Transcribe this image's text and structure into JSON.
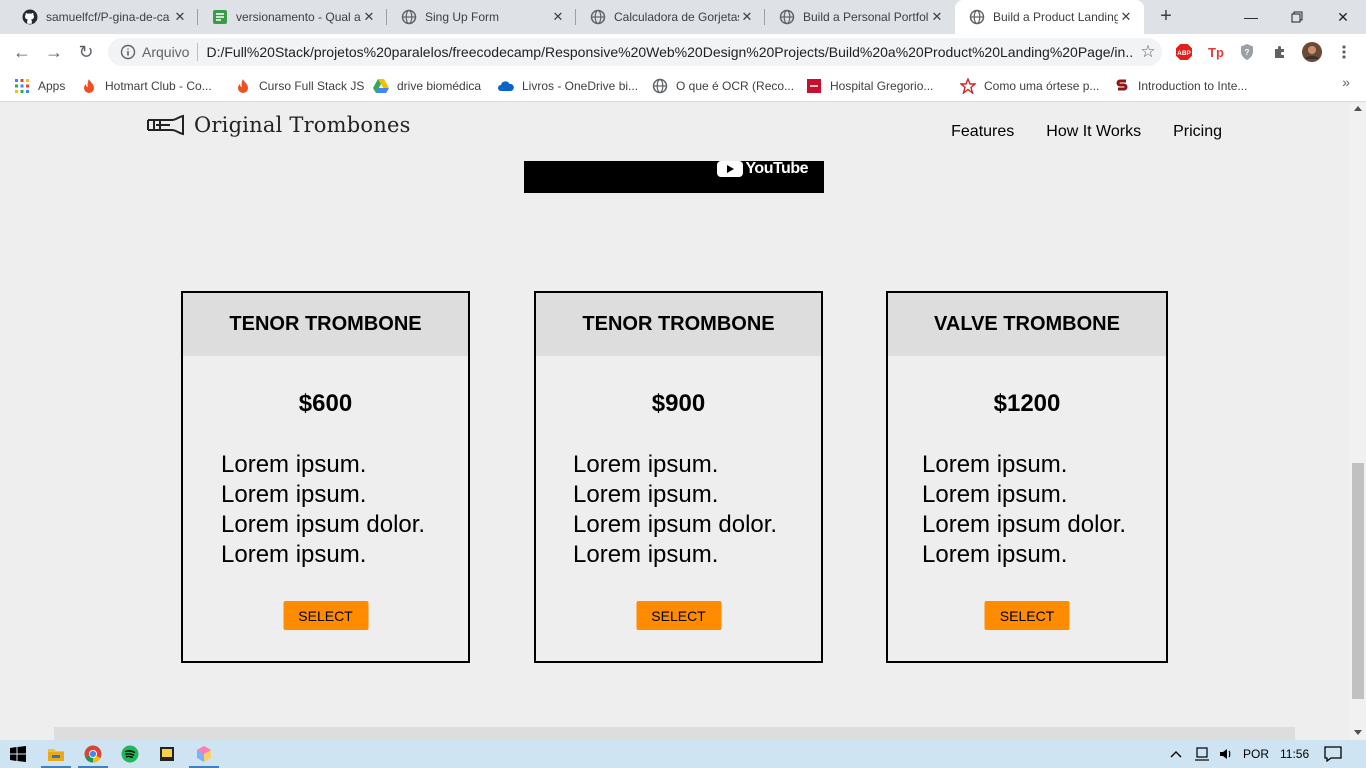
{
  "browser": {
    "tabs": [
      {
        "title": "samuelfcf/P-gina-de-ca",
        "icon": "github-icon"
      },
      {
        "title": "versionamento - Qual a",
        "icon": "stackexchange-icon"
      },
      {
        "title": "Sing Up Form",
        "icon": "globe-icon"
      },
      {
        "title": "Calculadora de Gorjetas",
        "icon": "globe-icon"
      },
      {
        "title": "Build a Personal Portfoli",
        "icon": "globe-icon"
      },
      {
        "title": "Build a Product Landing",
        "icon": "globe-icon",
        "active": true
      }
    ],
    "new_tab_label": "+",
    "address": {
      "scheme_label": "Arquivo",
      "url": "D:/Full%20Stack/projetos%20paralelos/freecodecamp/Responsive%20Web%20Design%20Projects/Build%20a%20Product%20Landing%20Page/in..."
    },
    "extensions": [
      "abp-icon",
      "tp-icon",
      "shield-icon",
      "puzzle-icon",
      "profile-avatar"
    ],
    "bookmarks": [
      {
        "label": "Apps",
        "icon": "apps-grid-icon"
      },
      {
        "label": "Hotmart Club - Co...",
        "icon": "hotmart-icon"
      },
      {
        "label": "Curso Full Stack JS",
        "icon": "hotmart-icon"
      },
      {
        "label": "drive biomédica",
        "icon": "google-drive-icon"
      },
      {
        "label": "Livros - OneDrive bi...",
        "icon": "onedrive-icon"
      },
      {
        "label": "O que é OCR (Reco...",
        "icon": "globe-icon"
      },
      {
        "label": "Hospital Gregorio...",
        "icon": "hospital-icon"
      },
      {
        "label": "Como uma órtese p...",
        "icon": "star-logo-icon"
      },
      {
        "label": "Introduction to Inte...",
        "icon": "stanford-icon"
      }
    ],
    "bookmarks_more": "»"
  },
  "page": {
    "logo_text": "Original Trombones",
    "nav": [
      "Features",
      "How It Works",
      "Pricing"
    ],
    "video_brand": "YouTube",
    "cards": [
      {
        "title": "TENOR TROMBONE",
        "price": "$600",
        "features": [
          "Lorem ipsum.",
          "Lorem ipsum.",
          "Lorem ipsum dolor.",
          "Lorem ipsum."
        ],
        "button": "SELECT"
      },
      {
        "title": "TENOR TROMBONE",
        "price": "$900",
        "features": [
          "Lorem ipsum.",
          "Lorem ipsum.",
          "Lorem ipsum dolor.",
          "Lorem ipsum."
        ],
        "button": "SELECT"
      },
      {
        "title": "VALVE TROMBONE",
        "price": "$1200",
        "features": [
          "Lorem ipsum.",
          "Lorem ipsum.",
          "Lorem ipsum dolor.",
          "Lorem ipsum."
        ],
        "button": "SELECT"
      }
    ]
  },
  "taskbar": {
    "apps": [
      "windows-start-icon",
      "file-explorer-icon",
      "chrome-icon",
      "spotify-icon",
      "sticky-notes-icon",
      "paint-3d-icon"
    ],
    "language": "POR",
    "time": "11:56"
  },
  "colors": {
    "accent_button": "#ff8c00",
    "card_header_bg": "#dddddd",
    "page_bg": "#eeeeee"
  }
}
